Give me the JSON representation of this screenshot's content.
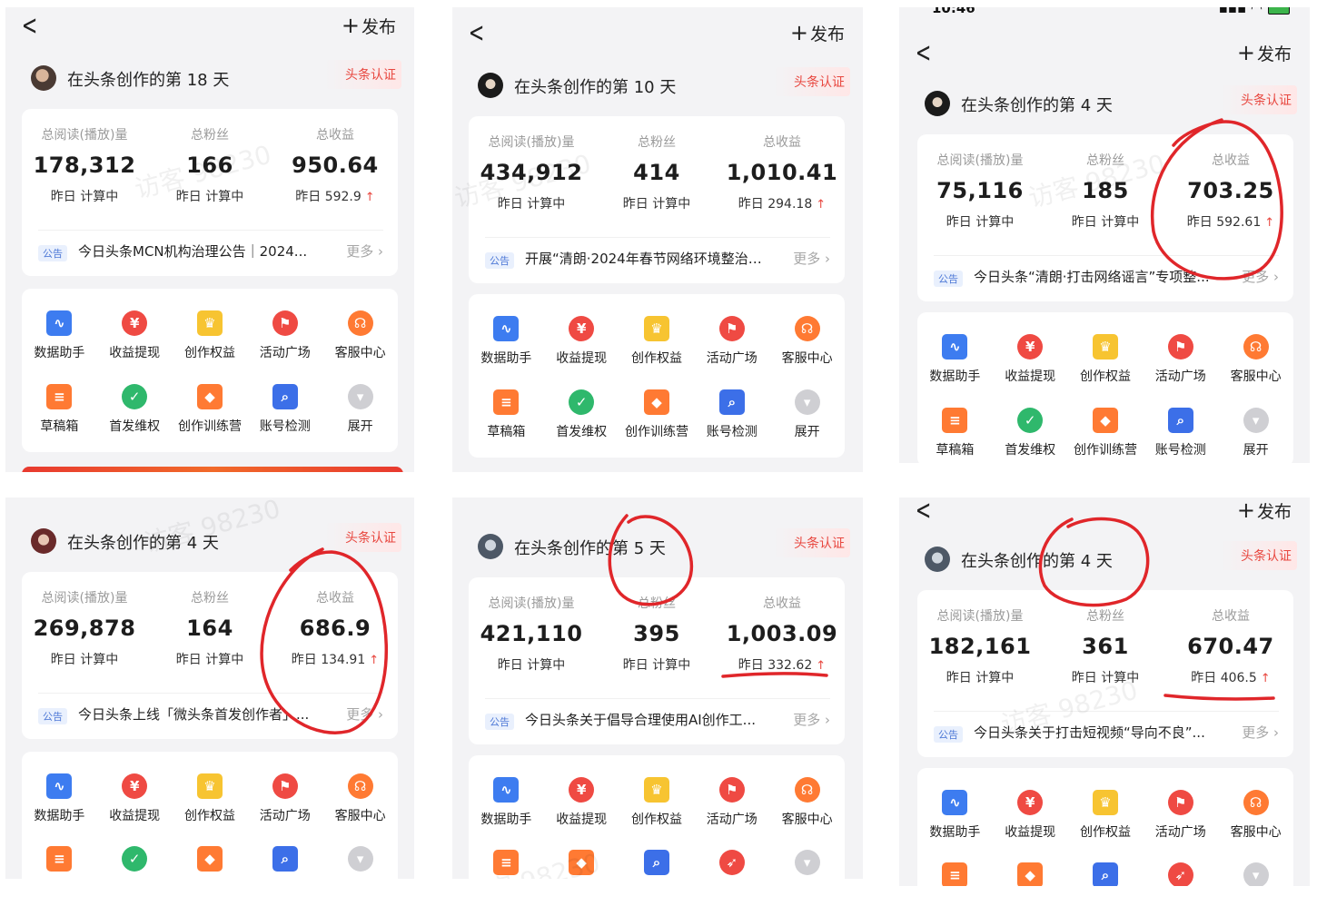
{
  "common": {
    "post_label": "发布",
    "verified_label": "头条认证",
    "notice_tag": "公告",
    "more_label": "更多",
    "stat_labels": [
      "总阅读(播放)量",
      "总粉丝",
      "总收益"
    ],
    "yesterday_prefix": "昨日",
    "calculating": "计算中",
    "tools_row1": [
      "数据助手",
      "收益提现",
      "创作权益",
      "活动广场",
      "客服中心"
    ],
    "tools_row2": [
      "草稿箱",
      "首发维权",
      "创作训练营",
      "账号检测",
      "展开"
    ]
  },
  "statusbar": {
    "time": "10:46"
  },
  "watermark_text": "访客 98230",
  "panels": [
    {
      "title": "在头条创作的第 18 天",
      "reads": "178,312",
      "fans": "166",
      "income": "950.64",
      "income_yesterday": "592.9",
      "notice": "今日头条MCN机构治理公告｜2024..."
    },
    {
      "title": "在头条创作的第 10 天",
      "reads": "434,912",
      "fans": "414",
      "income": "1,010.41",
      "income_yesterday": "294.18",
      "notice": "开展“清朗·2024年春节网络环境整治”..."
    },
    {
      "title": "在头条创作的第 4 天",
      "reads": "75,116",
      "fans": "185",
      "income": "703.25",
      "income_yesterday": "592.61",
      "notice": "今日头条“清朗·打击网络谣言”专项整..."
    },
    {
      "title": "在头条创作的第 4 天",
      "reads": "269,878",
      "fans": "164",
      "income": "686.9",
      "income_yesterday": "134.91",
      "notice": "今日头条上线「微头条首发创作者」..."
    },
    {
      "title": "在头条创作的第 5 天",
      "reads": "421,110",
      "fans": "395",
      "income": "1,003.09",
      "income_yesterday": "332.62",
      "notice": "今日头条关于倡导合理使用AI创作工..."
    },
    {
      "title": "在头条创作的第 4 天",
      "reads": "182,161",
      "fans": "361",
      "income": "670.47",
      "income_yesterday": "406.5",
      "notice": "今日头条关于打击短视频“导向不良”..."
    }
  ]
}
